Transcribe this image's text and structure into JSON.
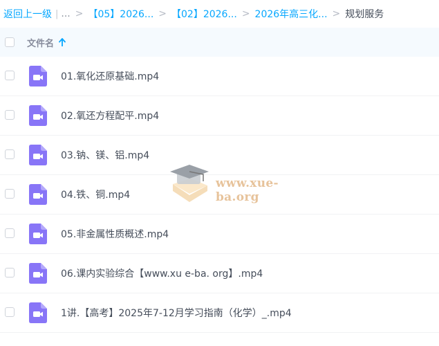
{
  "breadcrumb": {
    "back_label": "返回上一级",
    "pipe": "|",
    "ellipsis": "...",
    "sep": ">",
    "items": [
      "【05】2026...",
      "【02】2026...",
      "2026年高三化..."
    ],
    "current": "规划服务"
  },
  "header": {
    "name_label": "文件名"
  },
  "files": [
    {
      "name": "01.氧化还原基础.mp4",
      "icon": "video-file-icon"
    },
    {
      "name": "02.氧还方程配平.mp4",
      "icon": "video-file-icon"
    },
    {
      "name": "03.钠、镁、铝.mp4",
      "icon": "video-file-icon"
    },
    {
      "name": "04.铁、铜.mp4",
      "icon": "video-file-icon"
    },
    {
      "name": "05.非金属性质概述.mp4",
      "icon": "video-file-icon"
    },
    {
      "name": "06.课内实验综合【www.xu e-ba. org】.mp4",
      "icon": "video-file-icon"
    },
    {
      "name": "1讲.【高考】2025年7-12月学习指南（化学）_.mp4",
      "icon": "video-file-icon"
    }
  ],
  "watermark": {
    "text": "www.xue-ba.org"
  },
  "colors": {
    "link": "#06a7ff",
    "header_bg": "#f5fafe",
    "icon": "#8875f7"
  }
}
